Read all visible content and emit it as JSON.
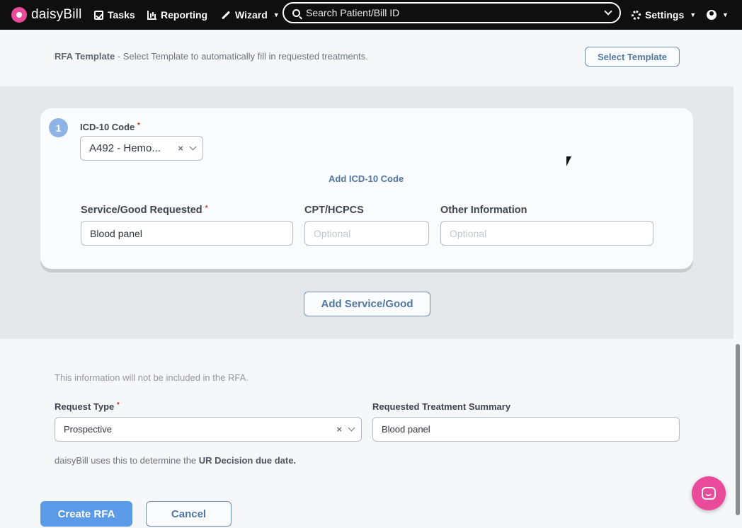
{
  "nav": {
    "logo_text": "daisyBill",
    "tasks": "Tasks",
    "reporting": "Reporting",
    "wizard": "Wizard",
    "search_placeholder": "Search Patient/Bill ID",
    "settings": "Settings"
  },
  "template": {
    "title": "RFA Template",
    "description": " - Select Template to automatically fill in requested treatments.",
    "button": "Select Template"
  },
  "treatment": {
    "number": "1",
    "icd_label": "ICD-10 Code",
    "icd_value": "A492 - Hemo...",
    "add_icd": "Add ICD-10 Code",
    "service_label": "Service/Good Requested",
    "service_value": "Blood panel",
    "cpt_label": "CPT/HCPCS",
    "cpt_placeholder": "Optional",
    "other_label": "Other Information",
    "other_placeholder": "Optional",
    "add_service": "Add Service/Good"
  },
  "lower": {
    "note": "This information will not be included in the RFA.",
    "request_type_label": "Request Type",
    "request_type_value": "Prospective",
    "summary_label": "Requested Treatment Summary",
    "summary_value": "Blood panel",
    "help_prefix": "daisyBill uses this to determine the ",
    "help_bold": "UR Decision due date."
  },
  "actions": {
    "create": "Create RFA",
    "cancel": "Cancel"
  },
  "required_mark": "*",
  "clear_mark": "×",
  "colors": {
    "brand": "#e94b9a",
    "primary": "#5b9ae6",
    "link": "#4f77a3"
  }
}
